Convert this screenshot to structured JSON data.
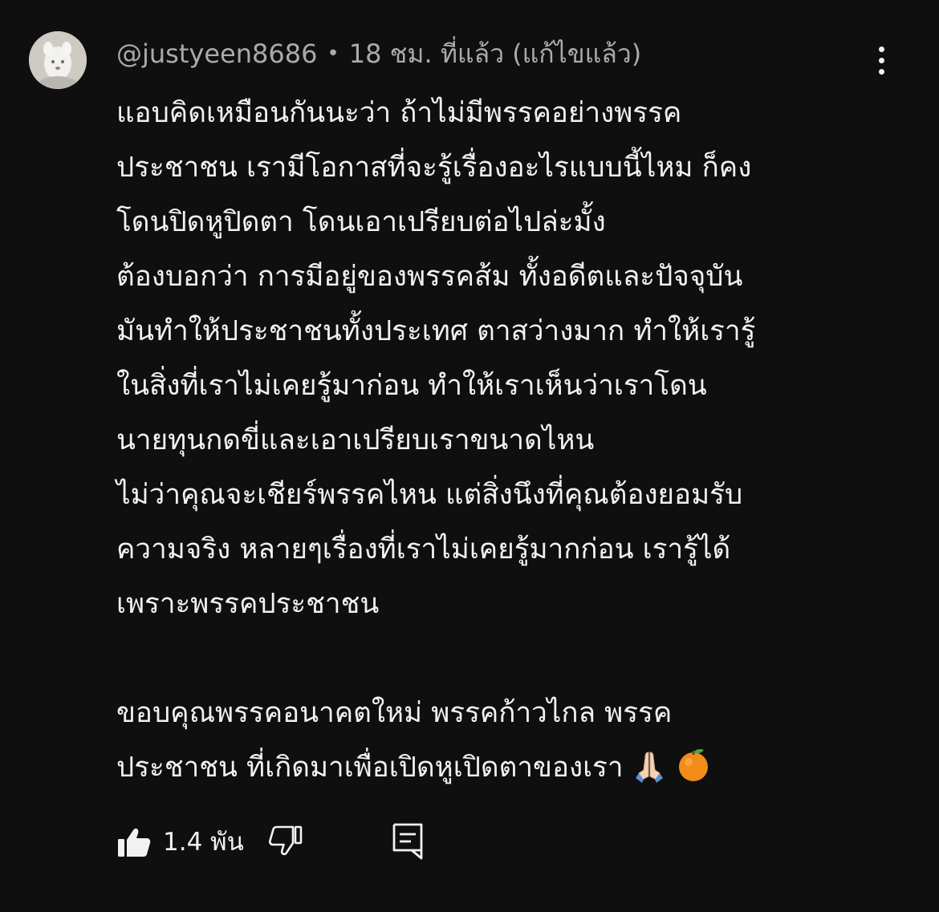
{
  "comment": {
    "author": "@justyeen8686",
    "separator": "•",
    "time": "18 ชม. ที่แล้ว",
    "edited": "(แก้ไขแล้ว)",
    "lines": [
      "แอบคิดเหมือนกันนะว่า ถ้าไม่มีพรรคอย่างพรรค",
      "ประชาชน เรามีโอกาสที่จะรู้เรื่องอะไรแบบนี้ไหม ก็คง",
      "โดนปิดหูปิดตา โดนเอาเปรียบต่อไปล่ะมั้ง",
      "ต้องบอกว่า การมีอยู่ของพรรคส้ม ทั้งอดีตและปัจจุบัน",
      "มันทำให้ประชาชนทั้งประเทศ ตาสว่างมาก ทำให้เรารู้",
      "ในสิ่งที่เราไม่เคยรู้มาก่อน ทำให้เราเห็นว่าเราโดน",
      "นายทุนกดขี่และเอาเปรียบเราขนาดไหน",
      "ไม่ว่าคุณจะเชียร์พรรคไหน แต่สิ่งนึงที่คุณต้องยอมรับ",
      "ความจริง หลายๆเรื่องที่เราไม่เคยรู้มากก่อน เรารู้ได้",
      "เพราะพรรคประชาชน",
      "ขอบคุณพรรคอนาคตใหม่ พรรคก้าวไกล พรรค",
      "ประชาชน ที่เกิดมาเพื่อเปิดหูเปิดตาของเรา"
    ],
    "emojis": [
      "folded-hands-emoji",
      "orange-emoji"
    ]
  },
  "actions": {
    "like_count": "1.4 พัน",
    "icons": [
      "thumbs-up-icon",
      "thumbs-down-icon",
      "reply-icon",
      "more-vertical-icon"
    ]
  },
  "colors": {
    "background": "#0f0f0f",
    "text": "#f1f1f1",
    "meta": "#aaaaaa"
  }
}
